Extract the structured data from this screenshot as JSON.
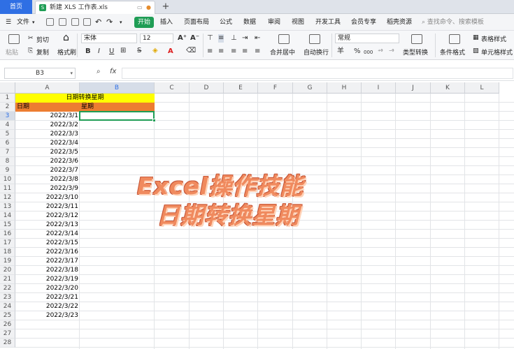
{
  "tabs": {
    "home": "首页",
    "file": "新建 XLS 工作表.xls",
    "file_logo": "S",
    "new": "+"
  },
  "menu": {
    "file": "文件",
    "start": "开始",
    "items": [
      "插入",
      "页面布局",
      "公式",
      "数据",
      "审阅",
      "视图",
      "开发工具",
      "会员专享",
      "稻壳资源"
    ],
    "search": "查找命令、搜索模板"
  },
  "ribbon": {
    "cut": "剪切",
    "copy": "复制",
    "format_painter": "格式刷",
    "paste": "粘贴",
    "font_name": "宋体",
    "font_size": "12",
    "bold": "B",
    "italic": "I",
    "underline": "U",
    "merge": "合并居中",
    "wrap": "自动换行",
    "number_format": "常规",
    "convert": "类型转换",
    "cond_format": "条件格式",
    "table_style": "表格样式",
    "cell_style": "单元格样式",
    "currency": "羊",
    "percent": "%",
    "thousands": "000"
  },
  "formula_bar": {
    "name_box": "B3",
    "fx": "fx",
    "value": ""
  },
  "columns": [
    "A",
    "B",
    "C",
    "D",
    "E",
    "F",
    "G",
    "H",
    "I",
    "J",
    "K",
    "L"
  ],
  "rows": [
    "1",
    "2",
    "3",
    "4",
    "5",
    "6",
    "7",
    "8",
    "9",
    "10",
    "11",
    "12",
    "13",
    "14",
    "15",
    "16",
    "17",
    "18",
    "19",
    "20",
    "21",
    "22",
    "23",
    "24",
    "25",
    "26",
    "27",
    "28"
  ],
  "sheet": {
    "title": "日期转换星期",
    "header_a": "日期",
    "header_b": "星期",
    "dates": [
      "2022/3/1",
      "2022/3/2",
      "2022/3/3",
      "2022/3/4",
      "2022/3/5",
      "2022/3/6",
      "2022/3/7",
      "2022/3/8",
      "2022/3/9",
      "2022/3/10",
      "2022/3/11",
      "2022/3/12",
      "2022/3/13",
      "2022/3/14",
      "2022/3/15",
      "2022/3/16",
      "2022/3/17",
      "2022/3/18",
      "2022/3/19",
      "2022/3/20",
      "2022/3/21",
      "2022/3/22",
      "2022/3/23"
    ]
  },
  "overlay": {
    "line1": "Excel操作技能",
    "line2": "日期转换星期"
  },
  "colors": {
    "title_fill": "#ffff00",
    "header_fill": "#ed7d31",
    "accent": "#1f9d55",
    "overlay_text": "#f08a5e"
  }
}
